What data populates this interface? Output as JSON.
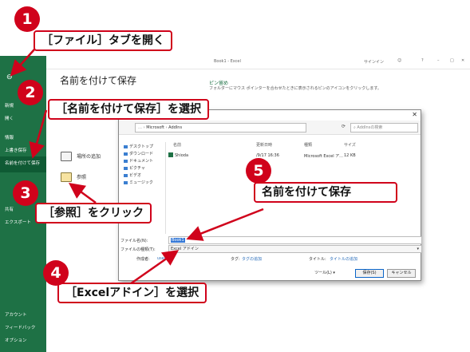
{
  "excel": {
    "window_title": "Book1 - Excel",
    "signin": "サインイン",
    "page_title": "名前を付けて保存",
    "rail": {
      "new": "新規",
      "open": "開く",
      "info": "情報",
      "save": "上書き保存",
      "save_as": "名前を付けて保存",
      "share": "共有",
      "export": "エクスポート",
      "account": "アカウント",
      "feedback": "フィードバック",
      "options": "オプション"
    },
    "places": {
      "add_place": "場所の追加",
      "browse": "参照"
    },
    "pinned": {
      "title": "ピン留め",
      "desc": "フォルダーにマウス ポインターを合わせたときに表示されるピンのアイコンをクリックします。"
    }
  },
  "dialog": {
    "path": [
      "Microsoft",
      "AddIns"
    ],
    "search_placeholder": "AddInsの検索",
    "nav": [
      "デスクトップ",
      "ダウンロード",
      "ドキュメント",
      "ピクチャ",
      "ビデオ",
      "ミュージック"
    ],
    "columns": {
      "name": "名前",
      "modified": "更新日時",
      "type": "種類",
      "size": "サイズ"
    },
    "file": {
      "name": "Shioda",
      "modified": "/9/17 16:36",
      "type": "Microsoft Excel ア...",
      "size": "12 KB"
    },
    "filename_label": "ファイル名(N):",
    "filename_value": "Book1",
    "filetype_label": "ファイルの種類(T):",
    "filetype_value": "Excel アドイン",
    "author_label": "作成者:",
    "author_value": "user",
    "tags_label": "タグ:",
    "tags_value": "タグの追加",
    "title_label": "タイトル:",
    "title_value": "タイトルの追加",
    "tools": "ツール(L)",
    "save": "保存(S)",
    "cancel": "キャンセル"
  },
  "callouts": [
    {
      "num": "1",
      "text": "［ファイル］タブを開く"
    },
    {
      "num": "2",
      "text": "［名前を付けて保存］を選択"
    },
    {
      "num": "3",
      "text": "［参照］をクリック"
    },
    {
      "num": "4",
      "text": "［Excelアドイン］を選択"
    },
    {
      "num": "5",
      "text": "名前を付けて保存"
    }
  ],
  "accent_color": "#d0021b",
  "excel_green": "#1e7145"
}
